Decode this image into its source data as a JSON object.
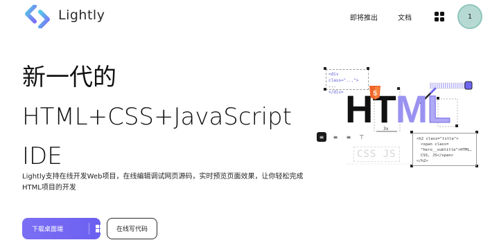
{
  "header": {
    "brand": "Lightly",
    "nav": {
      "upcoming": "即将推出",
      "docs": "文档"
    },
    "avatar_label": "1"
  },
  "hero": {
    "title_lines": [
      "新一代的",
      "HTML+CSS+JavaScript",
      "IDE"
    ],
    "subtitle": "Lightly支持在线开发Web项目，在线编辑调试网页源码，实时预览页面效果，让你轻松完成HTML项目的开发",
    "download_button": "下载桌面端",
    "code_button": "在线写代码"
  },
  "illustration": {
    "code_snippet_1": [
      "<div class=\"...\">",
      "...",
      "</div>"
    ],
    "code_snippet_2": [
      "<h2 class=\"title\">",
      "<span class=",
      "\"hero__subtitle\">HTML,",
      "CSS, JS</span>",
      "</h2>"
    ],
    "big_text": {
      "h": "H",
      "t": "T",
      "m": "M",
      "l": "L"
    },
    "faded_text": "CSS JS",
    "html5_badge": "5",
    "dimension_label": "3x"
  },
  "colors": {
    "accent": "#7066f2",
    "avatar_bg": "#b6dad3",
    "brand_gradient_start": "#55c8e8",
    "brand_gradient_end": "#7b6ff5",
    "html5_orange": "#f06529"
  },
  "icons": {
    "logo": "lightly-logo-icon",
    "grid": "apps-grid-icon",
    "windows": "windows-icon",
    "chevron": "chevron-down-icon",
    "html5": "html5-icon",
    "align_left": "align-left-icon",
    "align_center": "align-center-icon",
    "align_justify": "align-justify-icon",
    "strikethrough": "strikethrough-icon"
  }
}
